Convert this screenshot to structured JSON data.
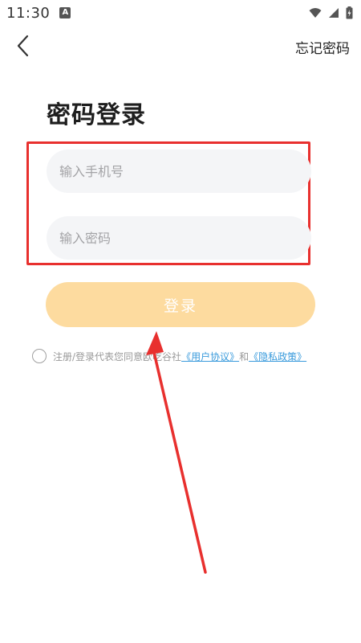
{
  "status_bar": {
    "time": "11:30",
    "notification_icon": "a-icon",
    "wifi_icon": "wifi-icon",
    "signal_icon": "signal-icon",
    "battery_icon": "battery-icon"
  },
  "header": {
    "back_icon": "chevron-left-icon",
    "forgot_password": "忘记密码"
  },
  "page_title": "密码登录",
  "form": {
    "phone_placeholder": "输入手机号",
    "phone_value": "",
    "password_placeholder": "输入密码",
    "password_value": "",
    "login_label": "登录"
  },
  "agreement": {
    "prefix": "注册/登录代表您同意欧",
    "mid_text": "吃谷社",
    "user_agreement": "《用户协议》",
    "and": "和",
    "privacy_policy": "《隐私政策》"
  },
  "annotation": {
    "highlight_color": "#e8302e"
  }
}
